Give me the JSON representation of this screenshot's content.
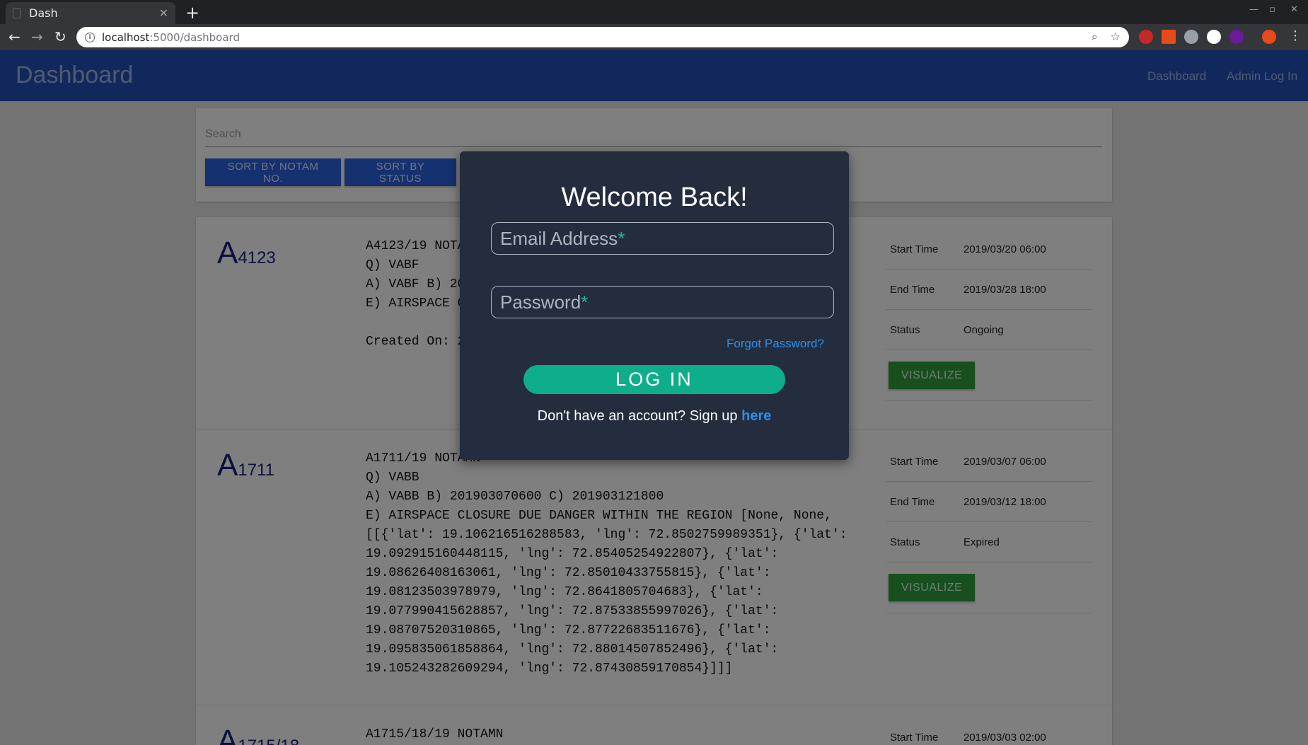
{
  "browser": {
    "tab_title": "Dash",
    "url_host": "localhost",
    "url_rest": ":5000/dashboard"
  },
  "app": {
    "brand": "Dashboard",
    "nav": [
      "Dashboard",
      "Admin Log In"
    ]
  },
  "search": {
    "placeholder": "Search",
    "sort_notam_label": "SORT BY NOTAM NO.",
    "sort_status_label": "SORT BY STATUS"
  },
  "notams": [
    {
      "letter": "A",
      "number": "4123",
      "text": "A4123/19 NOTAMN\nQ) VABF\nA) VABF B) 201903200600 C) 201903281800\nE) AIRSPACE CLOSURE DANGER\n\nCreated On: 2019/3/25 18:18",
      "start_label": "Start Time",
      "start": "2019/03/20 06:00",
      "end_label": "End Time",
      "end": "2019/03/28 18:00",
      "status_label": "Status",
      "status": "Ongoing",
      "button": "VISUALIZE"
    },
    {
      "letter": "A",
      "number": "1711",
      "text": "A1711/19 NOTAMN\nQ) VABB\nA) VABB B) 201903070600 C) 201903121800\nE) AIRSPACE CLOSURE DUE DANGER WITHIN THE REGION [None, None,\n[[{'lat': 19.106216516288583, 'lng': 72.8502759989351}, {'lat':\n19.092915160448115, 'lng': 72.85405254922807}, {'lat':\n19.08626408163061, 'lng': 72.85010433755815}, {'lat':\n19.08123503978979, 'lng': 72.8641805704683}, {'lat':\n19.077990415628857, 'lng': 72.87533855997026}, {'lat':\n19.08707520310865, 'lng': 72.87722683511676}, {'lat':\n19.095835061858864, 'lng': 72.88014507852496}, {'lat':\n19.105243282609294, 'lng': 72.87430859170854}]]]",
      "start_label": "Start Time",
      "start": "2019/03/07 06:00",
      "end_label": "End Time",
      "end": "2019/03/12 18:00",
      "status_label": "Status",
      "status": "Expired",
      "button": "VISUALIZE"
    },
    {
      "letter": "A",
      "number": "1715/18",
      "text": "A1715/18/19 NOTAMN",
      "start_label": "Start Time",
      "start": "2019/03/03 02:00"
    }
  ],
  "modal": {
    "title": "Welcome Back!",
    "email_placeholder": "Email Address",
    "password_placeholder": "Password",
    "required_mark": "*",
    "forgot": "Forgot Password?",
    "login": "LOG IN",
    "signup_text": "Don't have an account? Sign up ",
    "signup_link": "here"
  }
}
